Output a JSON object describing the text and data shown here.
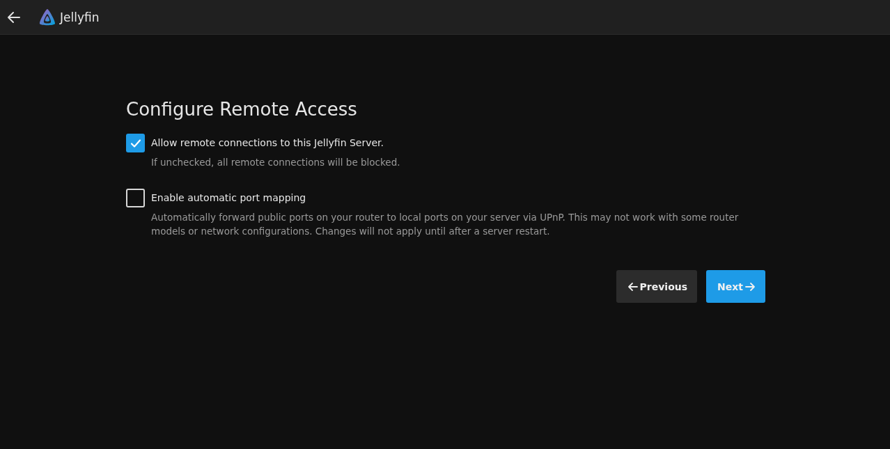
{
  "header": {
    "app_name": "Jellyfin"
  },
  "title": "Configure Remote Access",
  "options": [
    {
      "label": "Allow remote connections to this Jellyfin Server.",
      "description": "If unchecked, all remote connections will be blocked.",
      "checked": true
    },
    {
      "label": "Enable automatic port mapping",
      "description": "Automatically forward public ports on your router to local ports on your server via UPnP. This may not work with some router models or network configurations. Changes will not apply until after a server restart.",
      "checked": false
    }
  ],
  "buttons": [
    {
      "label": "Previous",
      "kind": "previous"
    },
    {
      "label": "Next",
      "kind": "next"
    }
  ]
}
